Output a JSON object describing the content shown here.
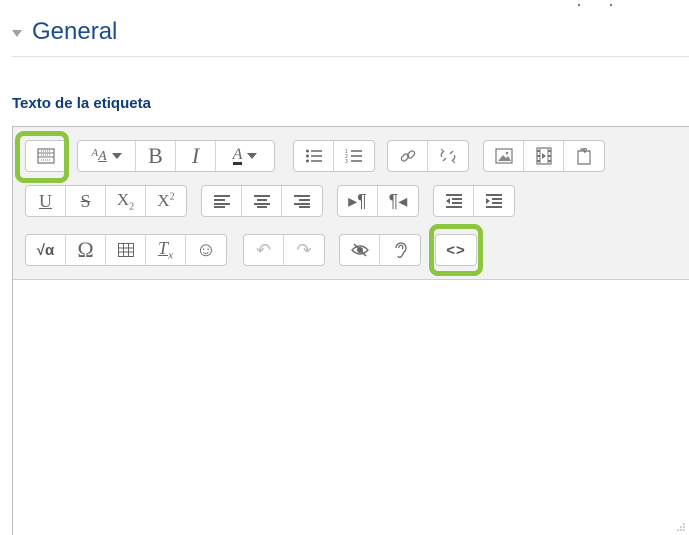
{
  "section": {
    "title": "General"
  },
  "field": {
    "label": "Texto de la etiqueta"
  },
  "toolbar": {
    "row1": {
      "g1": [
        {
          "name": "toolbar-toggle",
          "icon": "toolbar-toggle-icon"
        }
      ],
      "g2": [
        {
          "name": "font-size",
          "icon": "font-size-icon",
          "text": "AA",
          "caret": true
        },
        {
          "name": "bold",
          "icon": "bold-icon",
          "text": "B"
        },
        {
          "name": "italic",
          "icon": "italic-icon",
          "text": "I"
        },
        {
          "name": "font-color",
          "icon": "font-color-icon",
          "text": "A",
          "caret": true
        }
      ],
      "g3": [
        {
          "name": "unordered-list",
          "icon": "bullet-list-icon"
        },
        {
          "name": "ordered-list",
          "icon": "numbered-list-icon"
        }
      ],
      "g4": [
        {
          "name": "link",
          "icon": "link-icon"
        },
        {
          "name": "unlink",
          "icon": "unlink-icon"
        }
      ],
      "g5": [
        {
          "name": "image",
          "icon": "image-icon"
        },
        {
          "name": "media",
          "icon": "film-icon"
        },
        {
          "name": "manage-files",
          "icon": "file-icon"
        }
      ]
    },
    "row2": {
      "g1": [
        {
          "name": "underline",
          "icon": "underline-icon",
          "text": "U"
        },
        {
          "name": "strikethrough",
          "icon": "strikethrough-icon",
          "text": "S"
        },
        {
          "name": "subscript",
          "icon": "subscript-icon",
          "text": "X",
          "sub": "2"
        },
        {
          "name": "superscript",
          "icon": "superscript-icon",
          "text": "X",
          "sup": "2"
        }
      ],
      "g2": [
        {
          "name": "align-left",
          "icon": "align-left-icon"
        },
        {
          "name": "align-center",
          "icon": "align-center-icon"
        },
        {
          "name": "align-right",
          "icon": "align-right-icon"
        }
      ],
      "g3": [
        {
          "name": "ltr",
          "icon": "ltr-icon"
        },
        {
          "name": "rtl",
          "icon": "rtl-icon"
        }
      ],
      "g4": [
        {
          "name": "outdent",
          "icon": "outdent-icon"
        },
        {
          "name": "indent",
          "icon": "indent-icon"
        }
      ]
    },
    "row3": {
      "g1": [
        {
          "name": "equation",
          "icon": "equation-icon"
        },
        {
          "name": "special-char",
          "icon": "omega-icon",
          "text": "Ω"
        },
        {
          "name": "table",
          "icon": "table-icon"
        },
        {
          "name": "clear-format",
          "icon": "clear-format-icon",
          "text": "T"
        },
        {
          "name": "emoticon",
          "icon": "smiley-icon",
          "text": "☺"
        }
      ],
      "g2": [
        {
          "name": "undo",
          "icon": "undo-icon",
          "text": "↶",
          "disabled": true
        },
        {
          "name": "redo",
          "icon": "redo-icon",
          "text": "↷",
          "disabled": true
        }
      ],
      "g3": [
        {
          "name": "accessibility-checker",
          "icon": "eye-slash-icon"
        },
        {
          "name": "screenreader-helper",
          "icon": "ear-icon"
        }
      ],
      "g4": [
        {
          "name": "html",
          "icon": "code-icon",
          "text": "<>"
        }
      ]
    }
  },
  "colors": {
    "accent": "#8cc63f",
    "title": "#1a4d8f",
    "label": "#0f3c7a"
  }
}
